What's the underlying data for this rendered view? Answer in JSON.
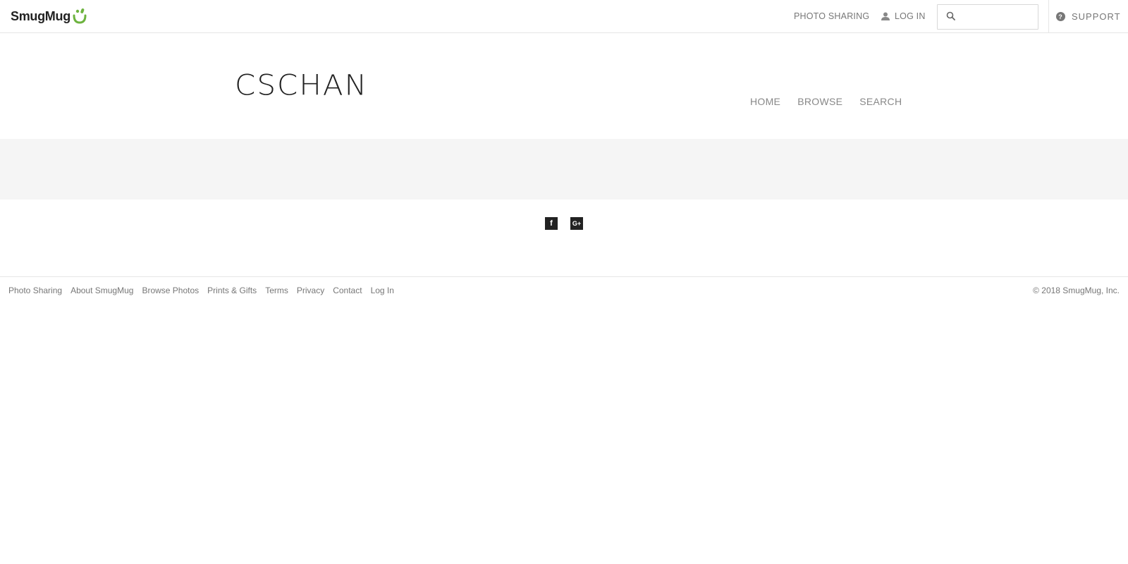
{
  "topbar": {
    "brand": "SmugMug",
    "photo_sharing": "PHOTO SHARING",
    "login": "LOG IN",
    "search_placeholder": "",
    "support": "SUPPORT",
    "support_badge": "?",
    "icons": {
      "user": "user-icon",
      "search": "search-icon",
      "help": "question-circle-icon"
    },
    "brand_color": "#6db33f"
  },
  "header": {
    "site_title": "CSCHAN",
    "nav": [
      "HOME",
      "BROWSE",
      "SEARCH"
    ]
  },
  "share": {
    "facebook": "f",
    "googleplus": "G+"
  },
  "footer": {
    "links": [
      "Photo Sharing",
      "About SmugMug",
      "Browse Photos",
      "Prints & Gifts",
      "Terms",
      "Privacy",
      "Contact",
      "Log In"
    ],
    "copyright": "© 2018 SmugMug, Inc."
  }
}
